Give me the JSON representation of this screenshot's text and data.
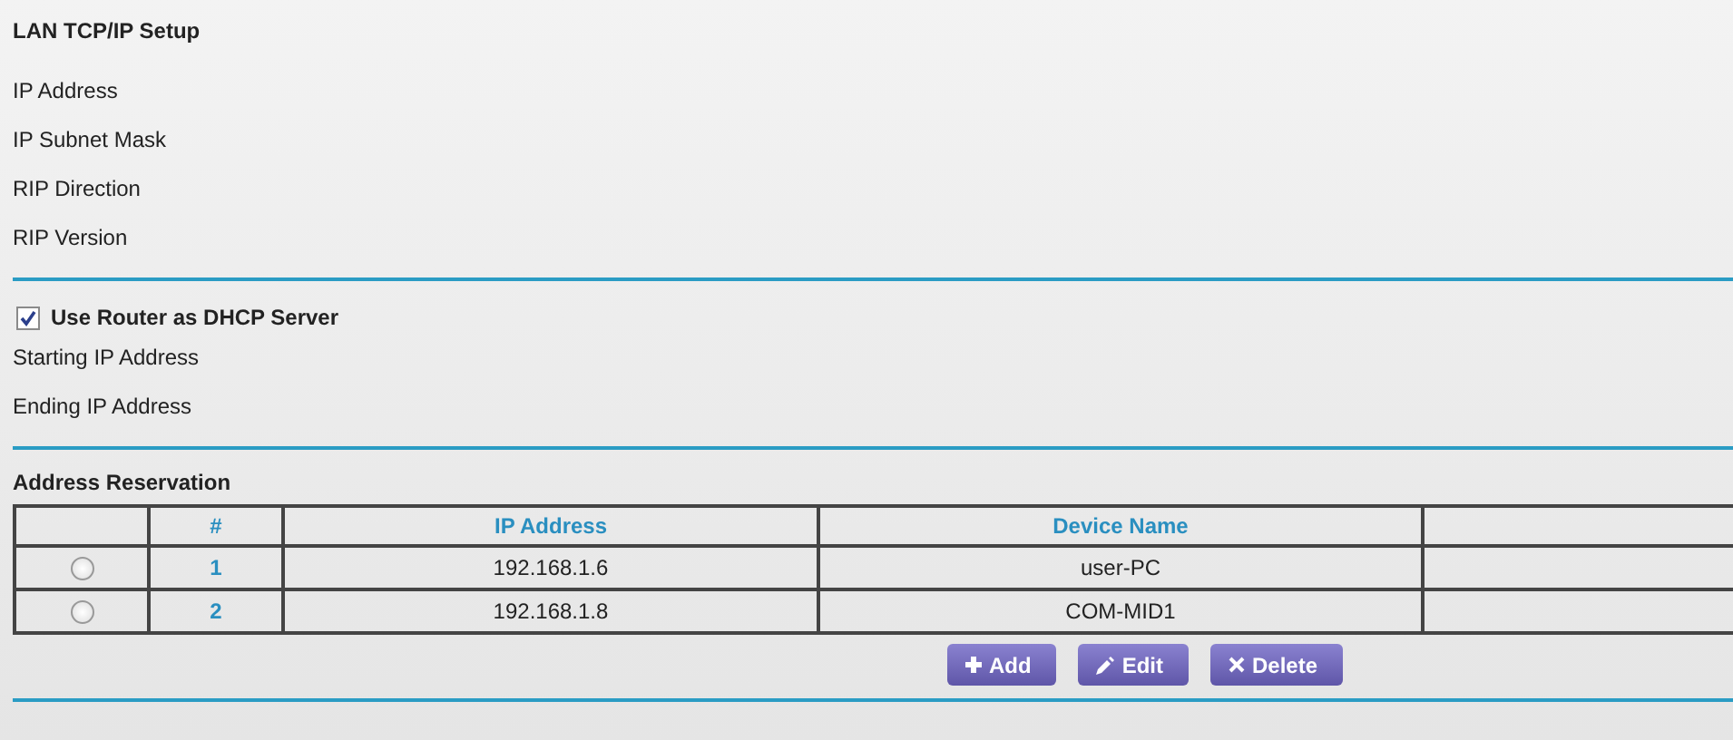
{
  "title": "LAN TCP/IP Setup",
  "lan_fields": [
    "IP Address",
    "IP Subnet Mask",
    "RIP Direction",
    "RIP Version"
  ],
  "dhcp": {
    "label": "Use Router as DHCP Server",
    "checked": true
  },
  "dhcp_fields": [
    "Starting IP Address",
    "Ending IP Address"
  ],
  "reservation": {
    "title": "Address Reservation",
    "columns": [
      "#",
      "IP Address",
      "Device Name"
    ],
    "rows": [
      {
        "selected": false,
        "number": "1",
        "ip": "192.168.1.6",
        "device": "user-PC"
      },
      {
        "selected": false,
        "number": "2",
        "ip": "192.168.1.8",
        "device": "COM-MID1"
      }
    ]
  },
  "buttons": [
    {
      "kind": "add",
      "label": "Add"
    },
    {
      "kind": "edit",
      "label": "Edit"
    },
    {
      "kind": "delete",
      "label": "Delete"
    }
  ]
}
